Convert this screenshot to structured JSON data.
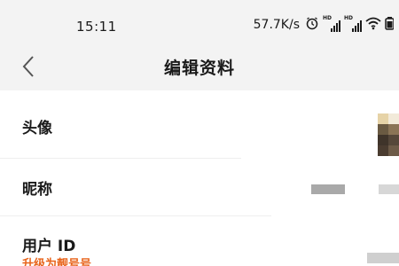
{
  "status_bar": {
    "time": "15:11",
    "net_speed": "57.7K/s",
    "icons": [
      "alarm-icon",
      "hd-signal-icon-1",
      "hd-signal-icon-2",
      "wifi-icon",
      "battery-icon"
    ],
    "hd_label": "HD"
  },
  "nav": {
    "title": "编辑资料",
    "back_icon": "chevron-left-icon"
  },
  "rows": {
    "avatar": {
      "label": "头像"
    },
    "nickname": {
      "label": "昵称"
    },
    "user_id": {
      "label": "用户 ID",
      "upgrade_text": "升级为靓号号"
    }
  },
  "colors": {
    "status_bg": "#f3f3f3",
    "nav_bg": "#f3f3f3",
    "accent": "#e8641b",
    "text": "#1a1a1a",
    "divider": "#eeeeee"
  }
}
